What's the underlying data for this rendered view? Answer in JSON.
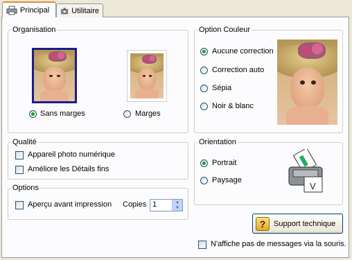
{
  "tabs": [
    {
      "label": "Principal",
      "icon": "printer-icon",
      "active": true
    },
    {
      "label": "Utilitaire",
      "icon": "tools-icon",
      "active": false
    }
  ],
  "organisation": {
    "title": "Organisation",
    "options": [
      {
        "label": "Sans marges",
        "selected": true
      },
      {
        "label": "Marges",
        "selected": false
      }
    ]
  },
  "qualite": {
    "title": "Qualité",
    "options": [
      {
        "label": "Appareil photo numérique",
        "checked": false
      },
      {
        "label": "Améliore les Détails fins",
        "checked": false
      }
    ]
  },
  "options_group": {
    "title": "Options",
    "preview_label": "Aperçu avant impression",
    "preview_checked": false,
    "copies_label": "Copies",
    "copies_value": "1"
  },
  "couleur": {
    "title": "Option Couleur",
    "options": [
      {
        "label": "Aucune correction",
        "selected": true
      },
      {
        "label": "Correction auto",
        "selected": false
      },
      {
        "label": "Sépia",
        "selected": false
      },
      {
        "label": "Noir & blanc",
        "selected": false
      }
    ]
  },
  "orientation": {
    "title": "Orientation",
    "options": [
      {
        "label": "Portrait",
        "selected": true
      },
      {
        "label": "Paysage",
        "selected": false
      }
    ]
  },
  "support_button": "Support technique",
  "no_messages": {
    "label": "N'affiche pas de messages via la souris.",
    "checked": false
  },
  "colors": {
    "accent": "#21a121",
    "selection_border": "#1c1c8c",
    "tab_highlight": "#e68b2c"
  }
}
